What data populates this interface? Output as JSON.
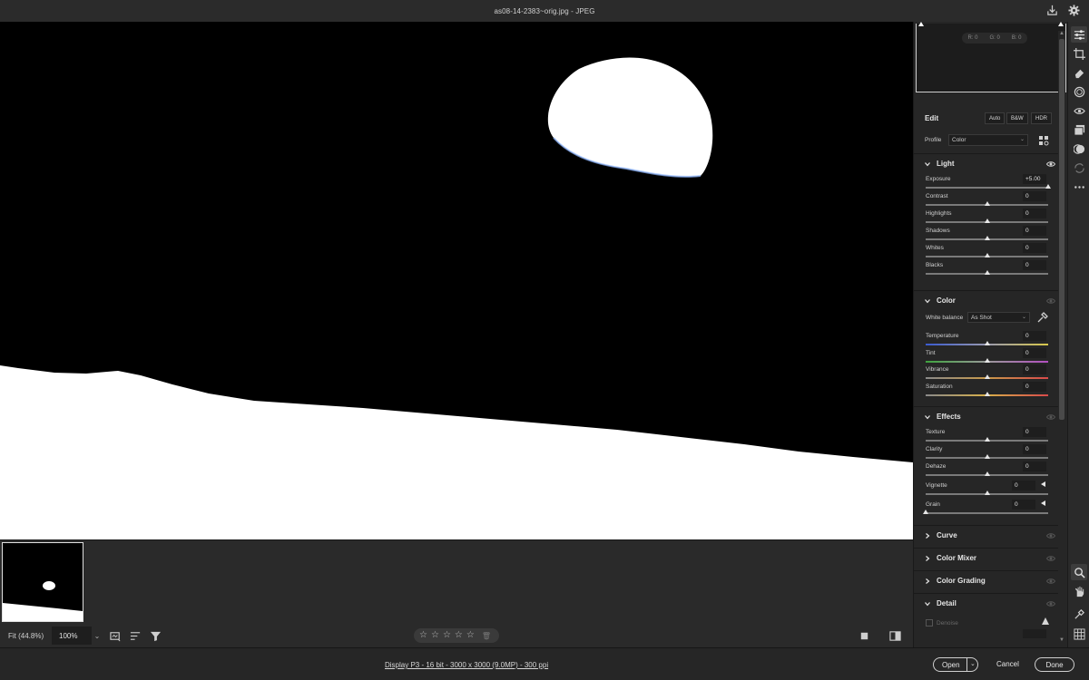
{
  "window": {
    "title": "as08-14-2383~orig.jpg  -  JPEG"
  },
  "toolbar_top": {
    "icons": [
      "save-icon",
      "gear-icon"
    ]
  },
  "bottom_bar": {
    "fit_label": "Fit (44.8%)",
    "zoom_value": "100%",
    "rating_stars": 0
  },
  "status_bar": {
    "file_info": "Display P3 - 16 bit - 3000 x 3000 (9.0MP) - 300 ppi",
    "open_label": "Open",
    "cancel_label": "Cancel",
    "done_label": "Done"
  },
  "histogram": {
    "r": "R: 0",
    "g": "G: 0",
    "b": "B: 0"
  },
  "edit": {
    "title": "Edit",
    "auto_label": "Auto",
    "bw_label": "B&W",
    "hdr_label": "HDR",
    "profile_label": "Profile",
    "profile_value": "Color"
  },
  "light": {
    "title": "Light",
    "sliders": [
      {
        "label": "Exposure",
        "value": "+5.00",
        "position": 1.0
      },
      {
        "label": "Contrast",
        "value": "0",
        "position": 0.5
      },
      {
        "label": "Highlights",
        "value": "0",
        "position": 0.5
      },
      {
        "label": "Shadows",
        "value": "0",
        "position": 0.5
      },
      {
        "label": "Whites",
        "value": "0",
        "position": 0.5
      },
      {
        "label": "Blacks",
        "value": "0",
        "position": 0.5
      }
    ]
  },
  "color": {
    "title": "Color",
    "wb_label": "White balance",
    "wb_value": "As Shot",
    "sliders": [
      {
        "label": "Temperature",
        "value": "0",
        "position": 0.5
      },
      {
        "label": "Tint",
        "value": "0",
        "position": 0.5
      },
      {
        "label": "Vibrance",
        "value": "0",
        "position": 0.5
      },
      {
        "label": "Saturation",
        "value": "0",
        "position": 0.5
      }
    ]
  },
  "effects": {
    "title": "Effects",
    "sliders": [
      {
        "label": "Texture",
        "value": "0",
        "position": 0.5
      },
      {
        "label": "Clarity",
        "value": "0",
        "position": 0.5
      },
      {
        "label": "Dehaze",
        "value": "0",
        "position": 0.5
      },
      {
        "label": "Vignette",
        "value": "0",
        "position": 0.5
      },
      {
        "label": "Grain",
        "value": "0",
        "position": 0.0
      }
    ]
  },
  "collapsed_sections": [
    "Curve",
    "Color Mixer",
    "Color Grading"
  ],
  "detail": {
    "title": "Detail",
    "denoise_label": "Denoise"
  },
  "colors": {
    "accent": "#e6e6e6",
    "panel_bg": "#262626",
    "canvas_bg": "#000000"
  }
}
